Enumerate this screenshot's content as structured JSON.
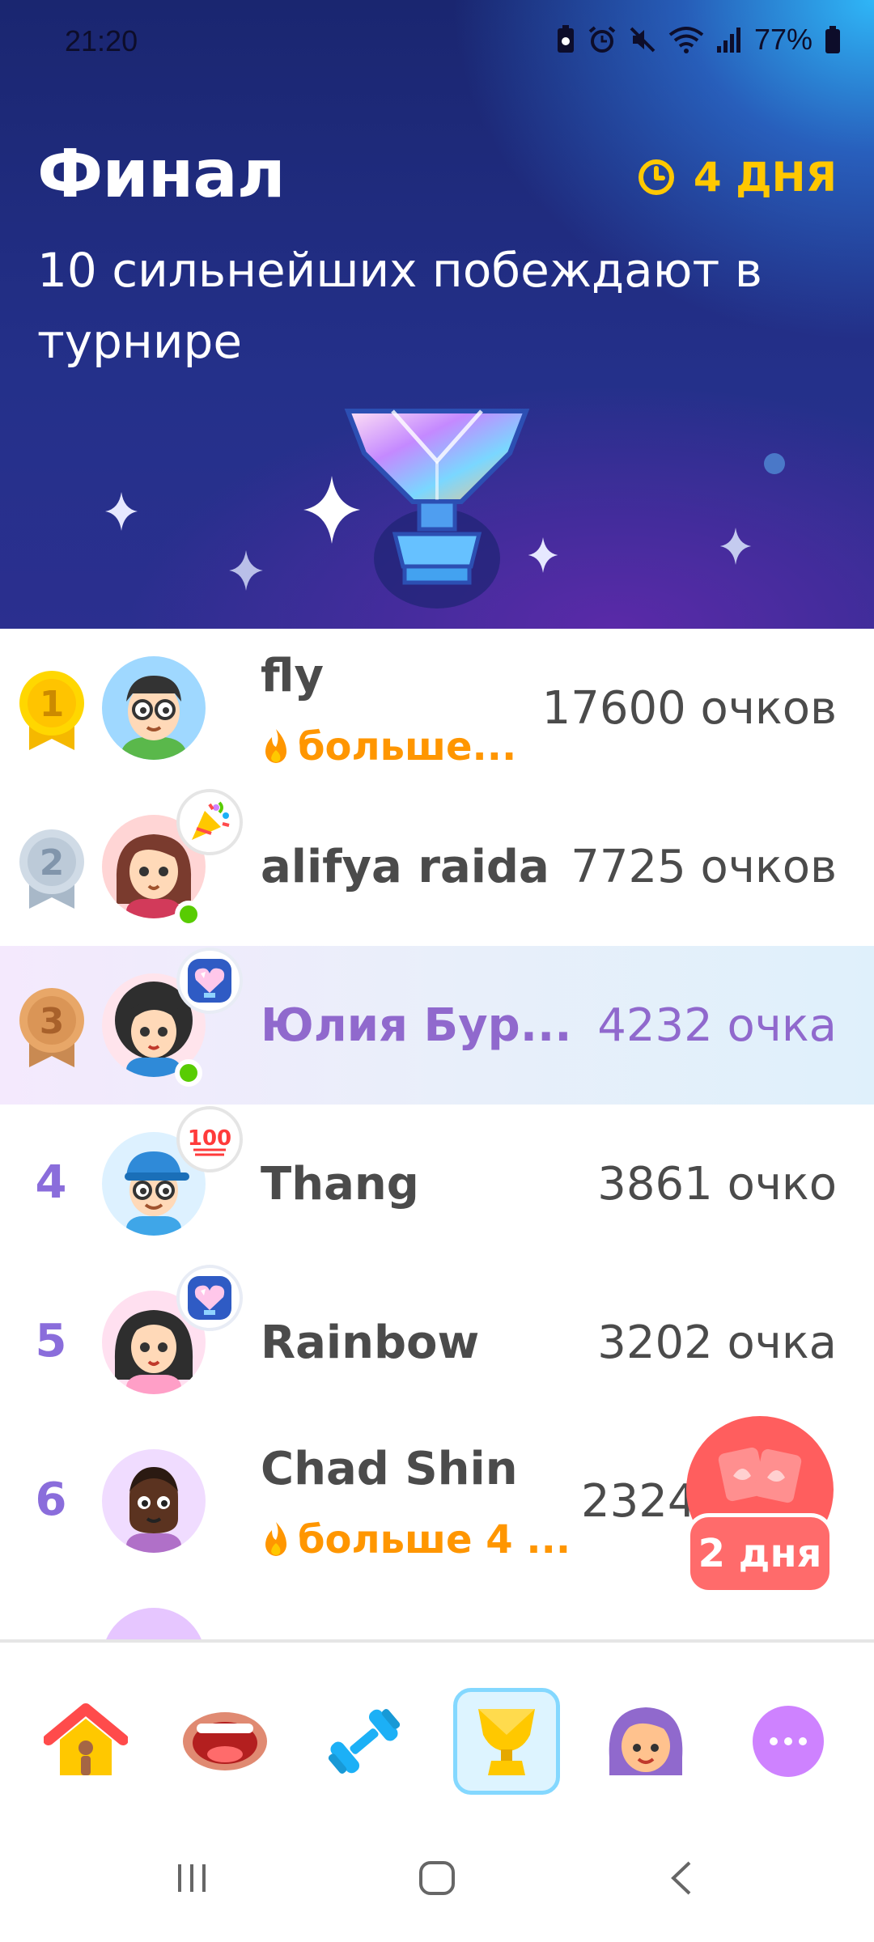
{
  "status_bar": {
    "time": "21:20",
    "battery": "77%"
  },
  "header": {
    "title": "Финал",
    "timer": "4 ДНЯ",
    "subtitle": "10 сильнейших побеждают в турнире"
  },
  "leaderboard": [
    {
      "rank": "1",
      "name": "fly",
      "score": "17600 очков",
      "streak": "больше...",
      "medal": "gold"
    },
    {
      "rank": "2",
      "name": "alifya raida",
      "score": "7725 очков",
      "medal": "silver",
      "badge": "party-popper-icon",
      "online": true
    },
    {
      "rank": "3",
      "name": "Юлия Бур...",
      "score": "4232 очка",
      "medal": "bronze",
      "badge": "heart-gem-icon",
      "online": true,
      "is_current_user": true
    },
    {
      "rank": "4",
      "name": "Thang",
      "score": "3861 очко",
      "badge": "hundred-icon"
    },
    {
      "rank": "5",
      "name": "Rainbow",
      "score": "3202 очка",
      "badge": "heart-gem-icon"
    },
    {
      "rank": "6",
      "name": "Chad Shin",
      "score": "2324",
      "streak": "больше 4 ..."
    }
  ],
  "chest": {
    "label": "2 дня"
  },
  "nav": {
    "items": [
      "home-icon",
      "speak-mouth-icon",
      "dumbbell-icon",
      "leaderboard-trophy-icon",
      "profile-avatar-icon",
      "more-icon"
    ],
    "active": "leaderboard-trophy-icon"
  },
  "colors": {
    "accent_gold": "#ffc800",
    "current_user": "#9069cd",
    "rank_number": "#8a6ddb",
    "streak": "#ff9600",
    "online": "#58cc02"
  }
}
